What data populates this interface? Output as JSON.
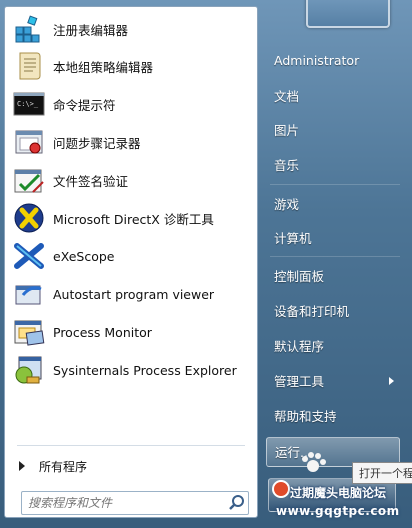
{
  "programs": [
    {
      "label": "注册表编辑器",
      "icon": "registry-editor-icon"
    },
    {
      "label": "本地组策略编辑器",
      "icon": "group-policy-icon"
    },
    {
      "label": "命令提示符",
      "icon": "command-prompt-icon"
    },
    {
      "label": "问题步骤记录器",
      "icon": "steps-recorder-icon"
    },
    {
      "label": "文件签名验证",
      "icon": "file-signature-icon"
    },
    {
      "label": "Microsoft DirectX 诊断工具",
      "icon": "directx-icon"
    },
    {
      "label": "eXeScope",
      "icon": "exescope-icon"
    },
    {
      "label": "Autostart program viewer",
      "icon": "autostart-viewer-icon"
    },
    {
      "label": "Process Monitor",
      "icon": "process-monitor-icon"
    },
    {
      "label": "Sysinternals Process Explorer",
      "icon": "process-explorer-icon"
    }
  ],
  "all_programs": "所有程序",
  "search": {
    "placeholder": "搜索程序和文件"
  },
  "right_items": {
    "user": "Administrator",
    "documents": "文档",
    "pictures": "图片",
    "music": "音乐",
    "games": "游戏",
    "computer": "计算机",
    "control_panel": "控制面板",
    "devices_printers": "设备和打印机",
    "default_programs": "默认程序",
    "admin_tools": "管理工具",
    "help": "帮助和支持",
    "run": "运行..."
  },
  "cmd_icon_text": "C:\\>_",
  "tooltip": "打开一个程",
  "watermark": {
    "title": "过期魔头电脑论坛",
    "url": "www.gqgtpc.com"
  },
  "colors": {
    "right_pane": "#4d7596",
    "left_pane": "#ffffff"
  }
}
